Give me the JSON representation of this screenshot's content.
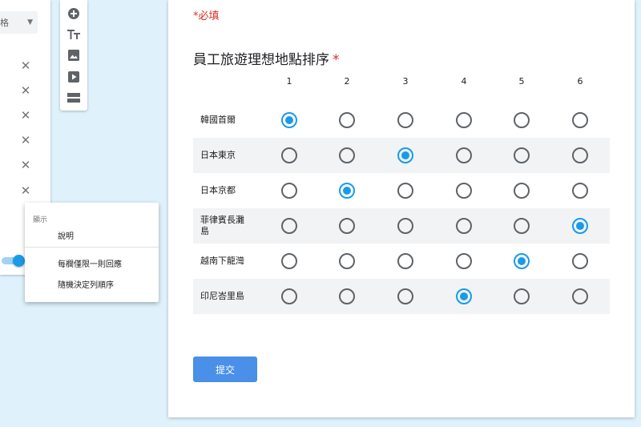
{
  "editor": {
    "type_select_label": "格",
    "close_glyph": "✕"
  },
  "toolbar": {
    "tools": [
      "add-question-icon",
      "title-text-icon",
      "image-icon",
      "video-icon",
      "section-icon"
    ]
  },
  "menu": {
    "header": "顯示",
    "description": "說明",
    "limit_one_per_column": "每欄僅限一則回應",
    "shuffle_rows": "隨機決定列順序"
  },
  "form": {
    "required_note": "*必填",
    "question_title": "員工旅遊理想地點排序",
    "required_mark": "*",
    "columns": [
      "1",
      "2",
      "3",
      "4",
      "5",
      "6"
    ],
    "rows": [
      {
        "label": "韓國首爾",
        "selected": 1
      },
      {
        "label": "日本東京",
        "selected": 3
      },
      {
        "label": "日本京都",
        "selected": 2
      },
      {
        "label": "菲律賓長灘島",
        "selected": 6
      },
      {
        "label": "越南下龍灣",
        "selected": 5
      },
      {
        "label": "印尼峇里島",
        "selected": 4
      }
    ],
    "submit_label": "提交"
  },
  "colors": {
    "accent": "#1a9be8",
    "submit": "#4a8fe8",
    "required": "#d93025",
    "background": "#dff2fc"
  }
}
